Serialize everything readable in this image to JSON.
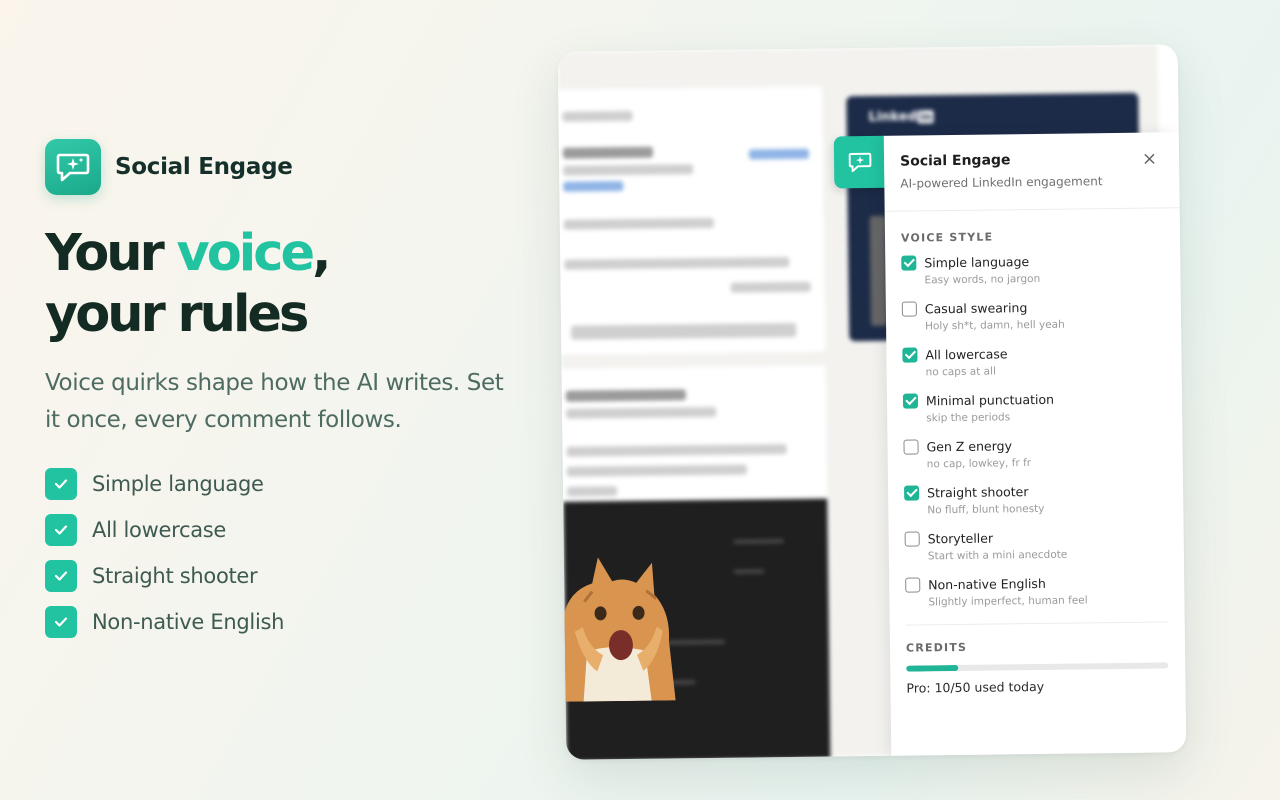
{
  "brand": {
    "name": "Social Engage"
  },
  "headline": {
    "line1_pre": "Your ",
    "line1_accent": "voice",
    "line1_post": ",",
    "line2": "your rules"
  },
  "subheading": "Voice quirks shape how the AI writes. Set it once, every comment follows.",
  "features": [
    "Simple language",
    "All lowercase",
    "Straight shooter",
    "Non-native English"
  ],
  "linkedin_card": {
    "logo_text": "Linked",
    "logo_in": "in"
  },
  "panel": {
    "title": "Social Engage",
    "subtitle": "AI-powered LinkedIn engagement",
    "close_icon": "×",
    "voice_style_title": "VOICE STYLE",
    "options": [
      {
        "label": "Simple language",
        "desc": "Easy words, no jargon",
        "checked": true
      },
      {
        "label": "Casual swearing",
        "desc": "Holy sh*t, damn, hell yeah",
        "checked": false
      },
      {
        "label": "All lowercase",
        "desc": "no caps at all",
        "checked": true
      },
      {
        "label": "Minimal punctuation",
        "desc": "skip the periods",
        "checked": true
      },
      {
        "label": "Gen Z energy",
        "desc": "no cap, lowkey, fr fr",
        "checked": false
      },
      {
        "label": "Straight shooter",
        "desc": "No fluff, blunt honesty",
        "checked": true
      },
      {
        "label": "Storyteller",
        "desc": "Start with a mini anecdote",
        "checked": false
      },
      {
        "label": "Non-native English",
        "desc": "Slightly imperfect, human feel",
        "checked": false
      }
    ],
    "credits_title": "CREDITS",
    "credits_used": 10,
    "credits_total": 50,
    "credits_text": "Pro: 10/50 used today"
  },
  "colors": {
    "accent": "#22c3a0",
    "accent_dark": "#1fb596",
    "linkedin_navy": "#1c2b48",
    "heading": "#142b24"
  },
  "icons": {
    "brand": "chat-sparkle-icon",
    "check": "check-icon",
    "close": "close-icon"
  }
}
